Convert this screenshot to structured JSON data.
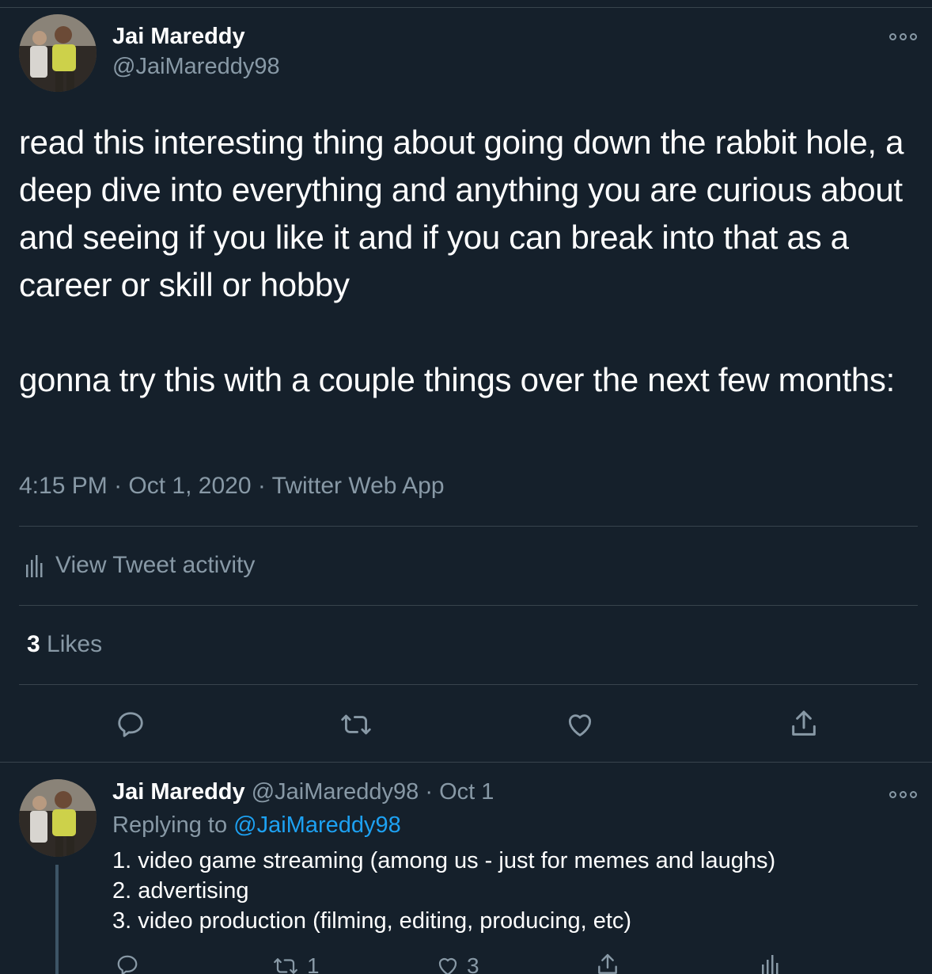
{
  "tweet": {
    "author_name": "Jai Mareddy",
    "author_handle": "@JaiMareddy98",
    "paragraphs": [
      "read this interesting thing about going down the rabbit hole, a deep dive into everything and anything you are curious about and seeing if you like it and if you can break into that as a career or skill or hobby",
      "gonna try this with a couple things over the next few months:"
    ],
    "time": "4:15 PM",
    "date": "Oct 1, 2020",
    "source": "Twitter Web App",
    "separator": "·",
    "activity_label": "View Tweet activity",
    "likes_count": "3",
    "likes_label": "Likes",
    "icons": [
      "more-icon",
      "reply-icon",
      "retweet-icon",
      "like-icon",
      "share-icon",
      "analytics-icon"
    ]
  },
  "reply": {
    "author_name": "Jai Mareddy",
    "author_handle": "@JaiMareddy98",
    "separator": "·",
    "date": "Oct 1",
    "replying_prefix": "Replying to",
    "replying_to": "@JaiMareddy98",
    "lines": [
      "1. video game streaming (among us - just for memes and laughs)",
      "2. advertising",
      "3. video production (filming, editing, producing, etc)"
    ],
    "retweet_count": "1",
    "like_count": "3"
  },
  "colors": {
    "background": "#15202b",
    "text_primary": "#ffffff",
    "text_secondary": "#8899a6",
    "link": "#1da1f2",
    "divider": "#38444d"
  }
}
